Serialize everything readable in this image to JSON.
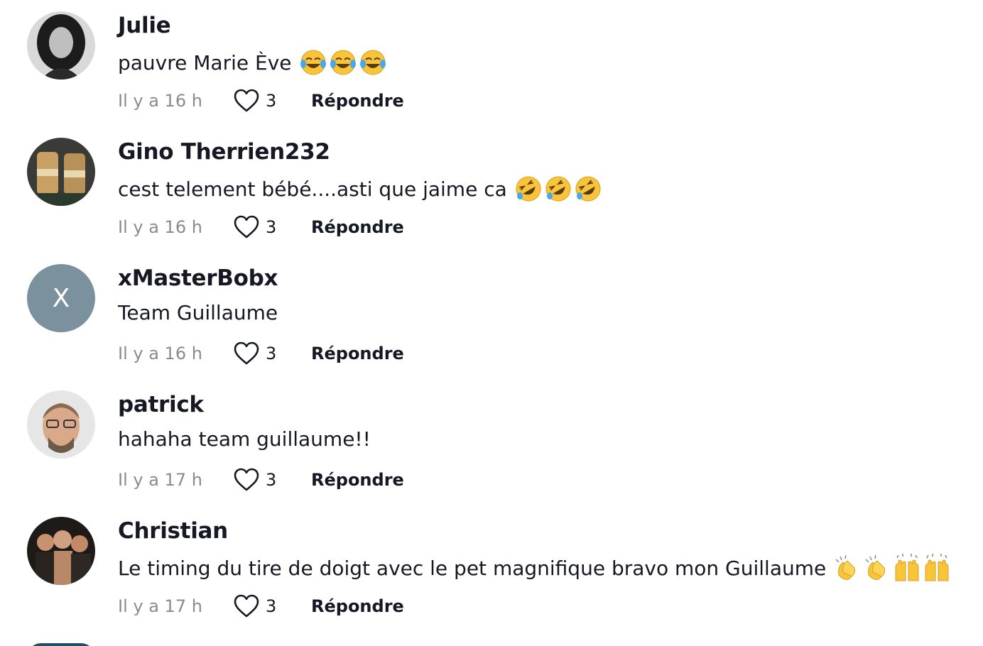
{
  "comments": [
    {
      "username": "Julie",
      "text": "pauvre Marie Ève",
      "emoji_icons": [
        "tears-of-joy-icon",
        "tears-of-joy-icon",
        "tears-of-joy-icon"
      ],
      "time": "Il y a 16 h",
      "likes": "3",
      "reply_label": "Répondre"
    },
    {
      "username": "Gino Therrien232",
      "text": "cest telement bébé....asti que jaime ca",
      "emoji_icons": [
        "rofl-icon",
        "rofl-icon",
        "rofl-icon"
      ],
      "time": "Il y a 16 h",
      "likes": "3",
      "reply_label": "Répondre"
    },
    {
      "username": "xMasterBobx",
      "avatar_letter": "X",
      "text": "Team Guillaume",
      "emoji_icons": [],
      "time": "Il y a 16 h",
      "likes": "3",
      "reply_label": "Répondre"
    },
    {
      "username": "patrick",
      "text": "hahaha team guillaume!!",
      "emoji_icons": [],
      "time": "Il y a 17 h",
      "likes": "3",
      "reply_label": "Répondre"
    },
    {
      "username": "Christian",
      "text": "Le timing du tire de doigt avec le pet magnifique bravo mon Guillaume",
      "emoji_icons": [
        "clapping-hands-icon",
        "clapping-hands-icon",
        "raising-hands-icon",
        "raising-hands-icon"
      ],
      "time": "Il y a 17 h",
      "likes": "3",
      "reply_label": "Répondre"
    }
  ],
  "colors": {
    "text": "#161823",
    "muted": "#8a8b91",
    "avatar_letter_bg": "#7b919e"
  }
}
